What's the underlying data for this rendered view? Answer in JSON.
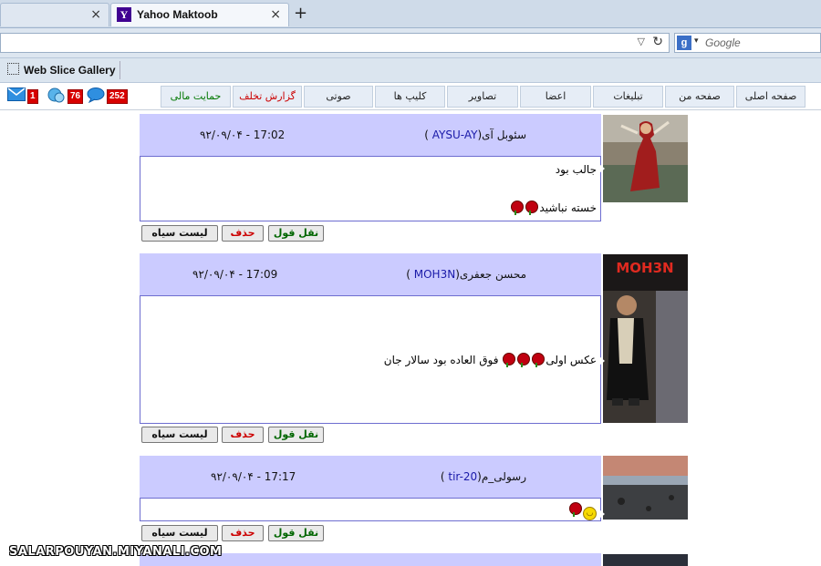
{
  "browser": {
    "tabs": [
      {
        "title": "",
        "close": "×"
      },
      {
        "title": "Yahoo Maktoob",
        "close": "×",
        "favicon": "Y"
      }
    ],
    "new_tab": "+",
    "address_value": "",
    "search_engine_icon": "g",
    "search_placeholder": "Google",
    "favorites": {
      "web_slice_gallery": "Web Slice Gallery"
    }
  },
  "nav": {
    "items": [
      {
        "label": "صفحه اصلی"
      },
      {
        "label": "صفحه من"
      },
      {
        "label": "تبلیغات"
      },
      {
        "label": "اعضا"
      },
      {
        "label": "تصاویر"
      },
      {
        "label": "کلیپ ها"
      },
      {
        "label": "صوتی"
      },
      {
        "label": "گزارش تخلف"
      },
      {
        "label": "حمایت مالی"
      }
    ],
    "notifications": {
      "messages": "1",
      "chat": "76",
      "comments": "252"
    }
  },
  "actions": {
    "quote": "نقل قول",
    "delete": "حذف",
    "blacklist": "لیست سیاه"
  },
  "messages": [
    {
      "date": "۹۲/۰۹/۰۴ - 17:02",
      "sender_name": "سئوبل آی",
      "sender_id": "AYSU-AY",
      "lines": [
        "جالب بود",
        "خسته نباشید"
      ]
    },
    {
      "date": "۹۲/۰۹/۰۴ - 17:09",
      "sender_name": "محسن جعفری",
      "sender_id": "MOH3N",
      "avatar_caption": "MOH3N",
      "lines": [
        "عکس اولی",
        "فوق العاده بود سالار جان"
      ]
    },
    {
      "date": "۹۲/۰۹/۰۴ - 17:17",
      "sender_name": "رسولی_م",
      "sender_id": "tir-20",
      "lines": []
    }
  ],
  "watermark": "SALARPOUYAN.MIYANALI.COM",
  "colors": {
    "header_bg": "#cbcbff",
    "border": "#6d6dd0",
    "sender_id": "#1a1aa8",
    "delete": "#cc0000",
    "quote": "#006600"
  }
}
